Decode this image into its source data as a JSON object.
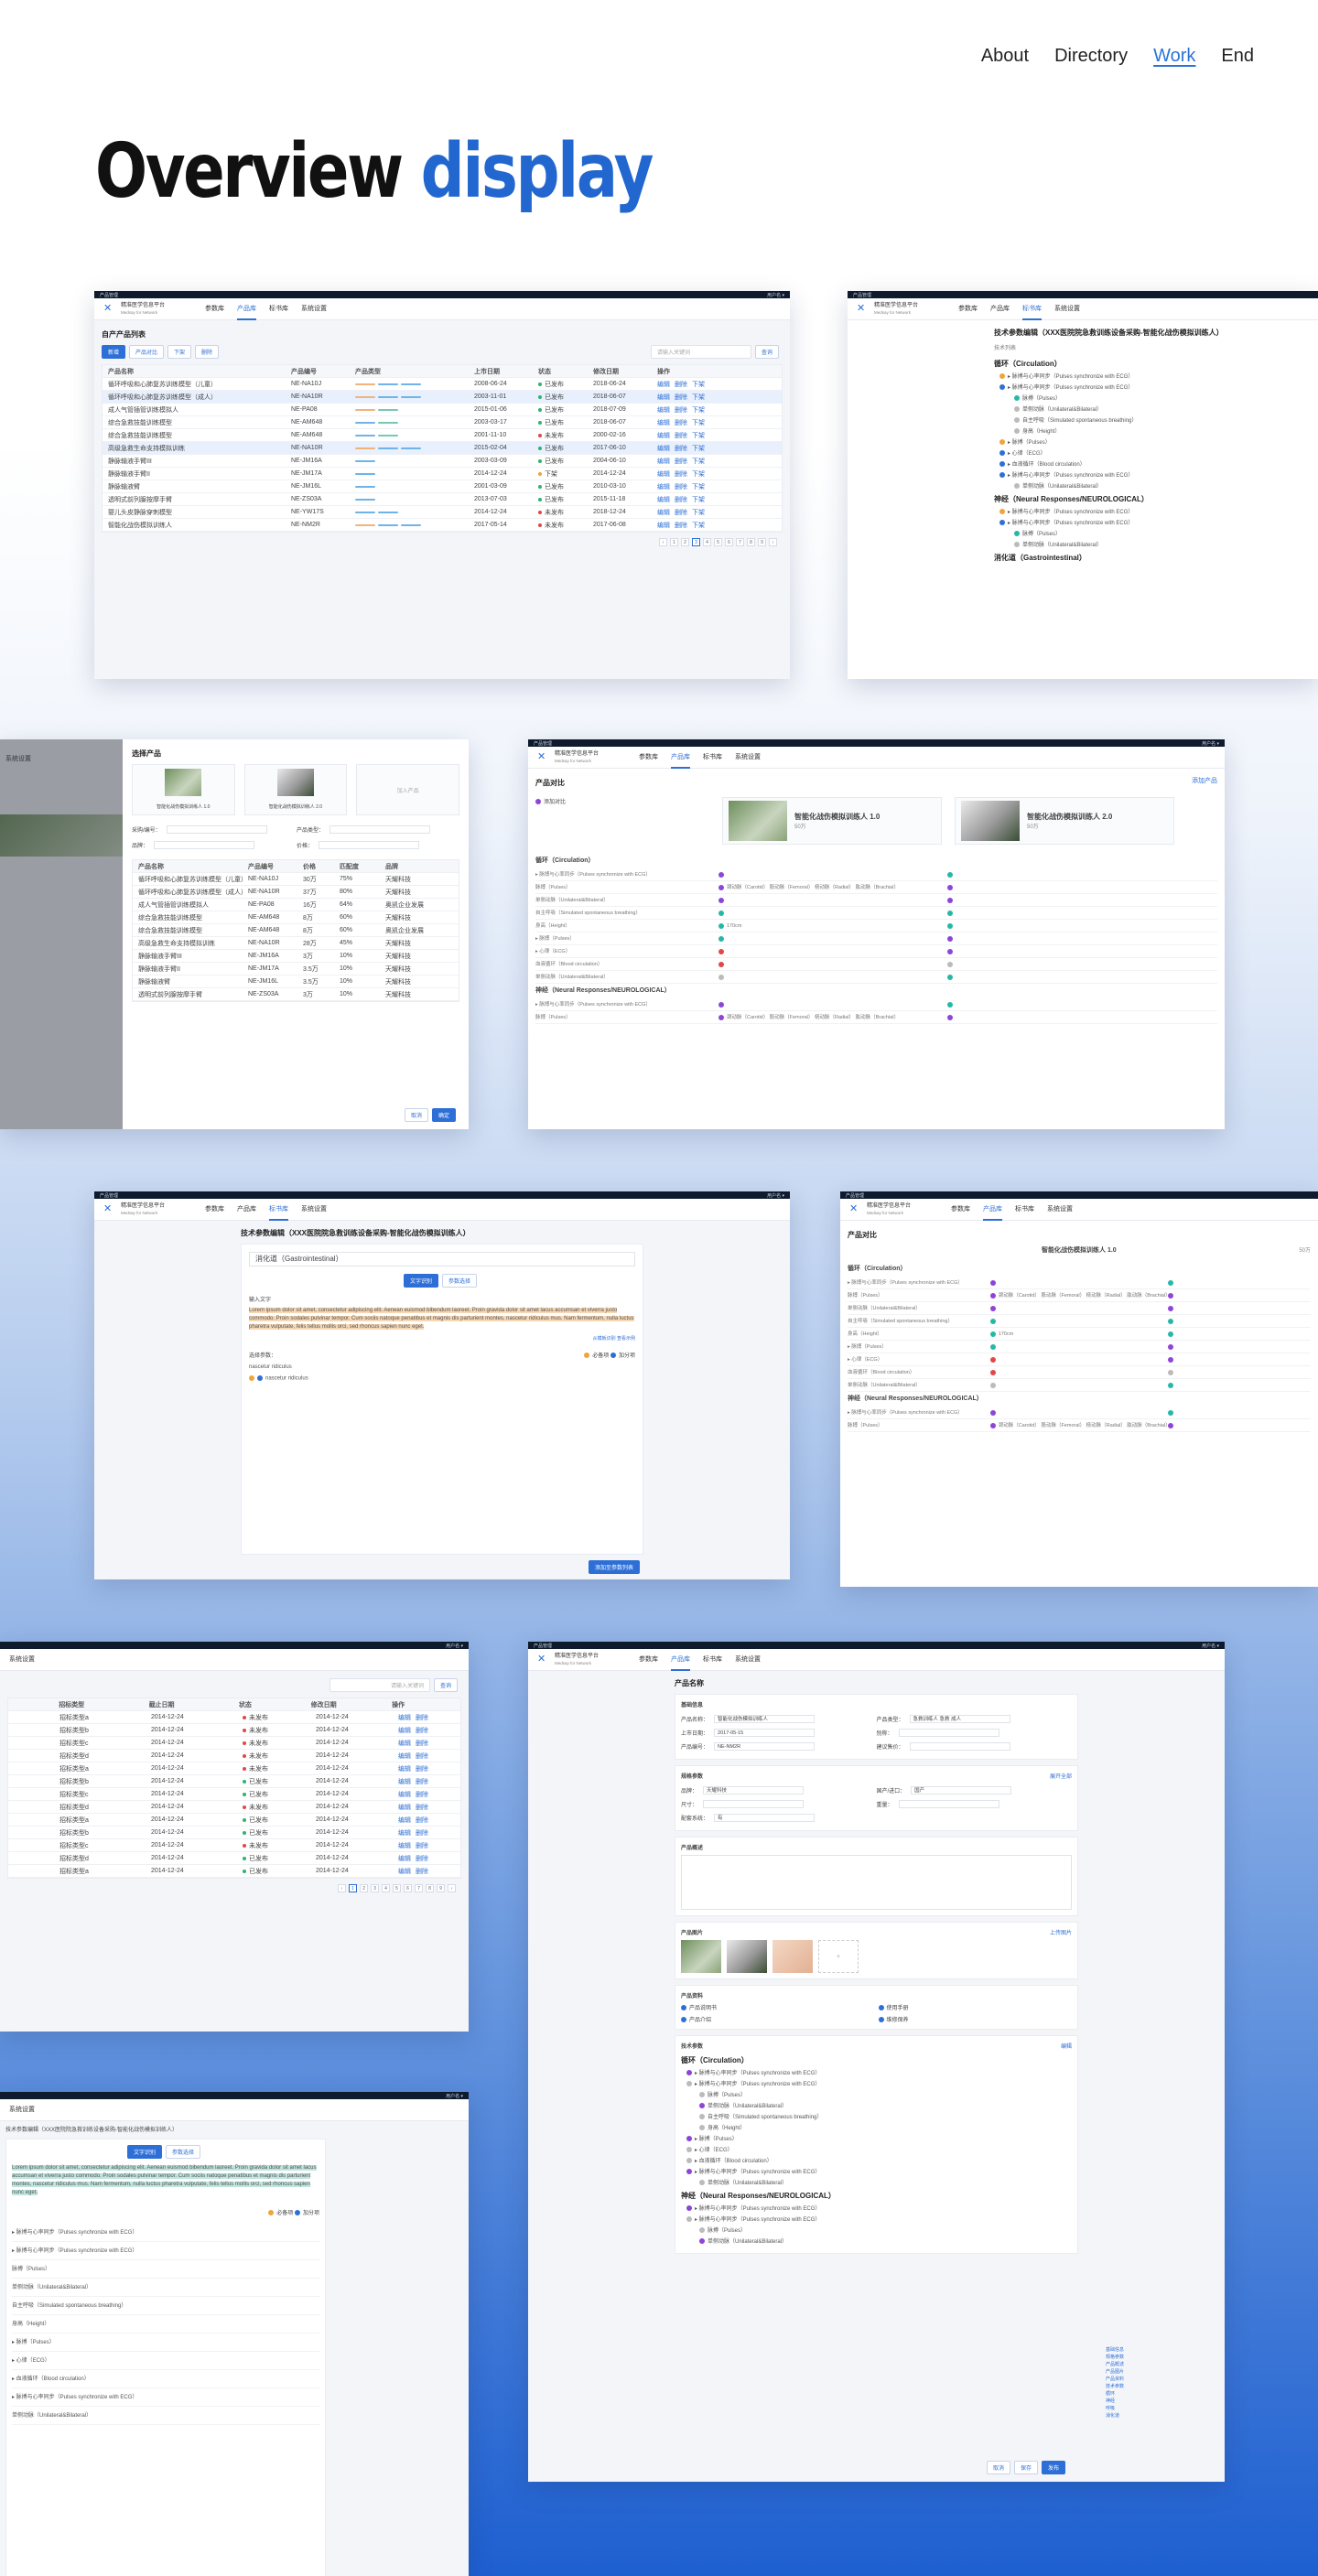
{
  "nav": {
    "items": [
      "About",
      "Directory",
      "Work",
      "End"
    ],
    "active": "Work"
  },
  "page": {
    "title_main": "Overview",
    "title_highlight": "display"
  },
  "colors": {
    "accent": "#2d6fd6",
    "title_highlight": "#2167cf",
    "ok": "#2fb36f",
    "warn": "#f0a43a",
    "error": "#e04848"
  },
  "app": {
    "name": "精准医学信息平台",
    "name_en": "Medsay for Network",
    "tabs": [
      "参数库",
      "产品库",
      "标书库",
      "系统设置"
    ],
    "topbar_left": "产品管理",
    "topbar_right": "用户名 ▾"
  },
  "list_screen": {
    "title": "自产产品列表",
    "buttons": [
      "新增",
      "产品对比",
      "下架",
      "删除"
    ],
    "search_placeholder": "请输入关键词",
    "search_btn": "查询",
    "columns": [
      "产品名称",
      "产品编号",
      "产品类型",
      "上市日期",
      "状态",
      "修改日期",
      "操作"
    ],
    "rows": [
      [
        "循环呼吸和心肺复苏训练模型（儿童）",
        "NE-NA10J",
        "",
        "2008-06-24",
        "已发布",
        "2018-06-24"
      ],
      [
        "循环呼吸和心肺复苏训练模型（成人）",
        "NE-NA10R",
        "",
        "2003-11-01",
        "已发布",
        "2018-06-07"
      ],
      [
        "成人气管插管训练模拟人",
        "NE-PA08",
        "",
        "2015-01-06",
        "已发布",
        "2018-07-09"
      ],
      [
        "综合急救技能训练模型",
        "NE-AM648",
        "",
        "2003-03-17",
        "已发布",
        "2018-06-07"
      ],
      [
        "综合急救技能训练模型",
        "NE-AM648",
        "",
        "2001-11-10",
        "未发布",
        "2000-02-16"
      ],
      [
        "高级急救生命支持模拟训练",
        "NE-NA10R",
        "",
        "2015-02-04",
        "已发布",
        "2017-06-10"
      ],
      [
        "静脉输液手臂III",
        "NE-JM16A",
        "",
        "2003-03-09",
        "已发布",
        "2004-06-10"
      ],
      [
        "静脉输液手臂II",
        "NE-JM17A",
        "",
        "2014-12-24",
        "下架",
        "2014-12-24"
      ],
      [
        "静脉输液臂",
        "NE-JM16L",
        "",
        "2001-03-09",
        "已发布",
        "2010-03-10"
      ],
      [
        "透明式前列腺按摩手臂",
        "NE-ZS03A",
        "",
        "2013-07-03",
        "已发布",
        "2015-11-18"
      ],
      [
        "婴儿头皮静脉穿刺模型",
        "NE-YW17S",
        "",
        "2014-12-24",
        "未发布",
        "2018-12-24"
      ],
      [
        "智能化战伤模拟训练人",
        "NE-NM2R",
        "",
        "2017-05-14",
        "未发布",
        "2017-06-08"
      ]
    ],
    "row_actions": [
      "编辑",
      "删除",
      "下架"
    ],
    "pages": [
      "‹",
      "1",
      "2",
      "3",
      "4",
      "5",
      "6",
      "7",
      "8",
      "9",
      "›"
    ]
  },
  "tree_screen": {
    "title": "技术参数编辑（XXX医院院急救训练设备采购-智能化战伤模拟训练人）",
    "subtitle": "技术列表",
    "sections": [
      {
        "name": "循环（Circulation）",
        "items": [
          "▸ 脉搏与心率同步（Pulses synchronize with ECG）",
          "▸ 脉搏与心率同步（Pulses synchronize with ECG）",
          "脉搏（Pulses）",
          "单侧动脉（Unilateral&Bilateral）",
          "自主呼吸（Simulated spontaneous breathing）",
          "身高（Height）",
          "▸ 脉搏（Pulses）",
          "▸ 心律（ECG）",
          "▸ 血液循环（Blood circulation）",
          "▸ 脉搏与心率同步（Pulses synchronize with ECG）",
          "单侧动脉（Unilateral&Bilateral）"
        ]
      },
      {
        "name": "神经（Neural Responses/NEUROLOGICAL）",
        "items": [
          "▸ 脉搏与心率同步（Pulses synchronize with ECG）",
          "▸ 脉搏与心率同步（Pulses synchronize with ECG）",
          "脉搏（Pulses）",
          "单侧动脉（Unilateral&Bilateral）"
        ]
      },
      {
        "name": "消化道（Gastrointestinal）",
        "items": []
      }
    ]
  },
  "picker_screen": {
    "title": "选择产品",
    "cards": [
      "智能化战伤模拟训练人 1.0",
      "智能化战伤模拟训练人 2.0",
      "加入产品"
    ],
    "filters": [
      "采购/编号：",
      "产品类型：",
      "品牌：",
      "价格："
    ],
    "columns": [
      "产品名称",
      "产品编号",
      "价格",
      "匹配度",
      "品牌"
    ],
    "rows": [
      [
        "循环呼吸和心肺复苏训练模型（儿童）",
        "NE-NA10J",
        "30万",
        "75%",
        "天耀科技"
      ],
      [
        "循环呼吸和心肺复苏训练模型（成人）",
        "NE-NA10R",
        "37万",
        "80%",
        "天耀科技"
      ],
      [
        "成人气管插管训练模拟人",
        "NE-PA08",
        "16万",
        "64%",
        "奥凯企业发展"
      ],
      [
        "综合急救技能训练模型",
        "NE-AM648",
        "8万",
        "60%",
        "天耀科技"
      ],
      [
        "综合急救技能训练模型",
        "NE-AM648",
        "8万",
        "60%",
        "奥凯企业发展"
      ],
      [
        "高级急救生命支持模拟训练",
        "NE-NA10R",
        "28万",
        "45%",
        "天耀科技"
      ],
      [
        "静脉输液手臂III",
        "NE-JM16A",
        "3万",
        "10%",
        "天耀科技"
      ],
      [
        "静脉输液手臂II",
        "NE-JM17A",
        "3.5万",
        "10%",
        "天耀科技"
      ],
      [
        "静脉输液臂",
        "NE-JM16L",
        "3.5万",
        "10%",
        "天耀科技"
      ],
      [
        "透明式前列腺按摩手臂",
        "NE-ZS03A",
        "3万",
        "10%",
        "天耀科技"
      ]
    ],
    "cancel": "取消",
    "confirm": "确定"
  },
  "compare_screen": {
    "title": "产品对比",
    "legend": "添加对比",
    "products": [
      {
        "name": "智能化战伤模拟训练人 1.0",
        "price": "50万"
      },
      {
        "name": "智能化战伤模拟训练人 2.0",
        "price": "50万"
      }
    ],
    "add_product": "添加产品",
    "sections": [
      {
        "name": "循环（Circulation）",
        "rows": [
          "▸ 脉搏与心率同步（Pulses synchronize with ECG）",
          "脉搏（Pulses）",
          "单侧动脉（Unilateral&Bilateral）",
          "自主呼吸（Simulated spontaneous breathing）",
          "身高（Height）",
          "▸ 脉搏（Pulses）",
          "▸ 心律（ECG）",
          "血液循环（Blood circulation）",
          "单侧动脉（Unilateral&Bilateral）"
        ]
      },
      {
        "name": "神经（Neural Responses/NEUROLOGICAL）",
        "rows": [
          "▸ 脉搏与心率同步（Pulses synchronize with ECG）",
          "脉搏（Pulses）"
        ]
      }
    ],
    "compare_a": [
      "颈动脉（Carotid）",
      "股动脉（Femoral）",
      "桡动脉（Radial）",
      "肱动脉（Brachial）"
    ],
    "height": "170cm"
  },
  "editor_screen": {
    "title": "技术参数编辑（XXX医院院急救训练设备采购-智能化战伤模拟训练人）",
    "select_value": "消化道（Gastrointestinal）",
    "toggle": [
      "文字识别",
      "参数选择"
    ],
    "label_input": "输入文字",
    "text": "Lorem ipsum dolor sit amet, consectetur adipiscing elit. Aenean euismod bibendum laoreet. Proin gravida dolor sit amet lacus accumsan et viverra justo commodo. Proin sodales pulvinar tempor. Cum sociis natoque penatibus et magnis dis parturient montes, nascetur ridiculus mus. Nam fermentum, nulla luctus pharetra vulputate, felis tellus mollis orci, sed rhoncus sapien nunc eget.",
    "links": [
      "从模板识别",
      "查看示例"
    ],
    "params_label": "选择参数：",
    "param_choices": [
      "必备项",
      "加分项"
    ],
    "param_tree": [
      "nascetur ridiculus",
      "nascetur ridiculus"
    ],
    "save": "添加至参数列表"
  },
  "detail_screen": {
    "title": "产品名称",
    "basic_title": "基础信息",
    "fields": {
      "产品名称": "智能化战伤模拟训练人",
      "产品类型": "急救训练人 急救 成人",
      "上市日期": "2017-05-15",
      "别称": "",
      "产品编号": "NE-NM2R",
      "建议售价": ""
    },
    "spec_title": "规格参数",
    "more": "展开全部",
    "spec_fields": {
      "品牌": "天耀科技",
      "国产/进口": "国产",
      "尺寸": "",
      "重量": "",
      "配套系统": "有"
    },
    "desc_title": "产品概述",
    "images_title": "产品图片",
    "upload": "上传图片",
    "docs_title": "产品资料",
    "docs": [
      "产品说明书",
      "使用手册",
      "产品介绍",
      "维修保养"
    ],
    "tech_title": "技术参数",
    "edit": "编辑",
    "side_nav": [
      "基础信息",
      "规格参数",
      "产品概述",
      "产品图片",
      "产品资料",
      "技术参数",
      "循环",
      "神经",
      "呼吸",
      "消化道"
    ],
    "actions": [
      "取消",
      "保存",
      "发布"
    ]
  },
  "bid_screen": {
    "search_placeholder": "请输入关键词",
    "search_btn": "查询",
    "columns": [
      "",
      "招标类型",
      "截止日期",
      "状态",
      "修改日期",
      "操作"
    ],
    "rows": [
      [
        "",
        "招标类型a",
        "2014-12-24",
        "未发布",
        "2014-12-24"
      ],
      [
        "",
        "招标类型b",
        "2014-12-24",
        "未发布",
        "2014-12-24"
      ],
      [
        "",
        "招标类型c",
        "2014-12-24",
        "未发布",
        "2014-12-24"
      ],
      [
        "",
        "招标类型d",
        "2014-12-24",
        "未发布",
        "2014-12-24"
      ],
      [
        "",
        "招标类型a",
        "2014-12-24",
        "未发布",
        "2014-12-24"
      ],
      [
        "",
        "招标类型b",
        "2014-12-24",
        "已发布",
        "2014-12-24"
      ],
      [
        "",
        "招标类型c",
        "2014-12-24",
        "已发布",
        "2014-12-24"
      ],
      [
        "",
        "招标类型d",
        "2014-12-24",
        "未发布",
        "2014-12-24"
      ],
      [
        "",
        "招标类型a",
        "2014-12-24",
        "已发布",
        "2014-12-24"
      ],
      [
        "",
        "招标类型b",
        "2014-12-24",
        "已发布",
        "2014-12-24"
      ],
      [
        "",
        "招标类型c",
        "2014-12-24",
        "未发布",
        "2014-12-24"
      ],
      [
        "",
        "招标类型d",
        "2014-12-24",
        "已发布",
        "2014-12-24"
      ],
      [
        "",
        "招标类型a",
        "2014-12-24",
        "已发布",
        "2014-12-24"
      ]
    ],
    "row_actions": [
      "编辑",
      "删除"
    ]
  }
}
